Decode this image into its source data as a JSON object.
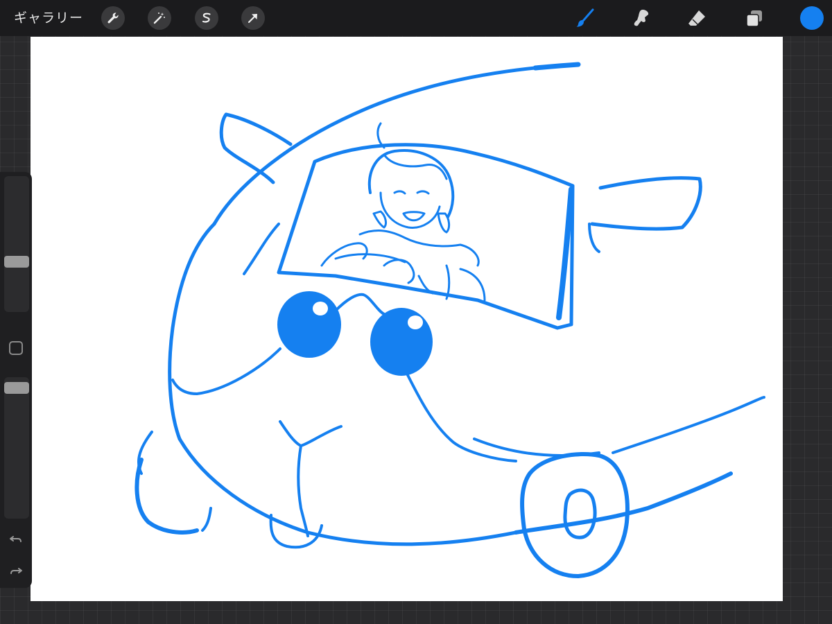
{
  "topbar": {
    "gallery_label": "ギャラリー",
    "left_tools": [
      {
        "icon": "wrench-icon",
        "name": "actions"
      },
      {
        "icon": "magic-wand-icon",
        "name": "adjustments"
      },
      {
        "icon": "selection-s-icon",
        "name": "selection"
      },
      {
        "icon": "arrow-cursor-icon",
        "name": "transform"
      }
    ],
    "right_tools": [
      {
        "icon": "brush-icon",
        "name": "brush",
        "active": true
      },
      {
        "icon": "smudge-icon",
        "name": "smudge",
        "active": false
      },
      {
        "icon": "eraser-icon",
        "name": "eraser",
        "active": false
      },
      {
        "icon": "layers-icon",
        "name": "layers",
        "active": false
      }
    ],
    "current_color": "#1580f0"
  },
  "sidebar": {
    "brush_size_level": 0.64,
    "opacity_level": 0.04,
    "modifier_icon": "square-modifier-icon",
    "undo_icon": "undo-icon",
    "redo_icon": "redo-icon"
  },
  "colors": {
    "accent": "#1580f0",
    "ink": "#1580f0",
    "toolbar_bg": "#1b1b1d",
    "canvas_bg": "#ffffff"
  }
}
